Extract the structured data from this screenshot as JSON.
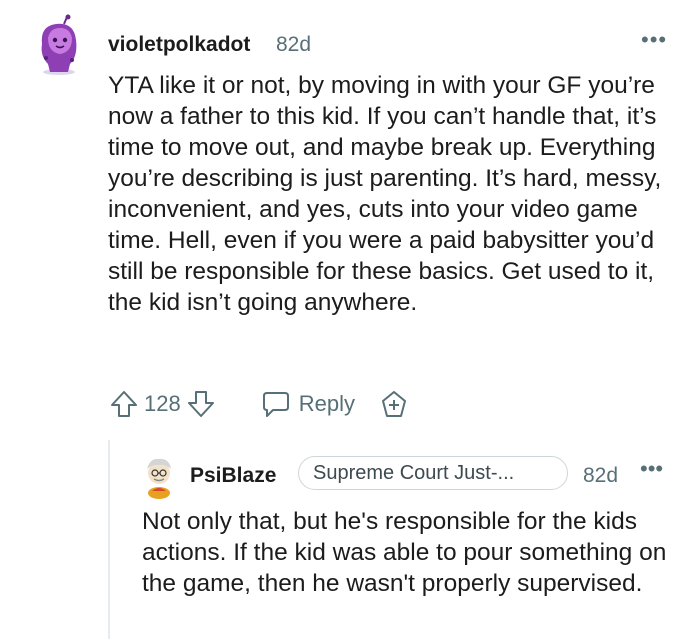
{
  "comment": {
    "username": "violetpolkadot",
    "age": "82d",
    "more": "•••",
    "body": "YTA like it or not, by moving in with your GF you’re now a father to this kid. If you can’t handle that, it’s time to move out, and maybe break up. Everything you’re describing is just parenting. It’s hard, messy, inconvenient, and yes, cuts into your video game time. Hell, even if you were a paid babysitter you’d still be responsible for these basics. Get used to it, the kid isn’t going anywhere.",
    "vote_count": "128",
    "reply_label": "Reply",
    "icons": {
      "upvote": "arrow-up-outline-icon",
      "downvote": "arrow-down-outline-icon",
      "reply": "speech-bubble-icon",
      "award": "award-plus-icon"
    }
  },
  "reply": {
    "username": "PsiBlaze",
    "flair": "Supreme Court Just-...",
    "age": "82d",
    "more": "•••",
    "body": "Not only that, but he's responsible for the kids actions. If the kid was able to pour something on the game, then he wasn't properly supervised."
  },
  "colors": {
    "text": "#1c1c1c",
    "meta": "#576f76",
    "avatar1": "#8e3fb4",
    "thread_line": "#e5ebee"
  }
}
